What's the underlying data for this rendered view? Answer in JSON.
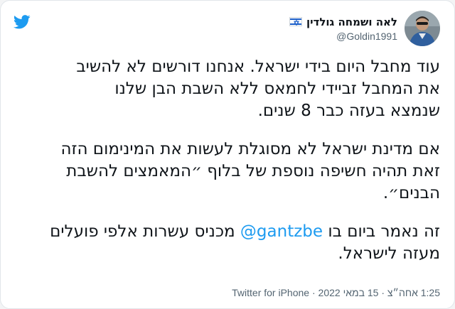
{
  "tweet": {
    "author": {
      "display_name": "לאה ושמחה גולדין",
      "handle": "@Goldin1991",
      "flag_icon": "israel-flag-icon",
      "avatar_icon": "profile-photo"
    },
    "paragraphs": [
      {
        "lines": "עוד מחבל היום בידי ישראל. אנחנו דורשים לא להשיב\nאת המחבל זביידי לחמאס ללא השבת הבן שלנו\nשנמצא בעזה כבר 8 שנים."
      },
      {
        "lines": "אם מדינת ישראל לא מסוגלת לעשות את המינימום הזה\nזאת תהיה חשיפה נוספת של בלוף ״המאמצים להשבת\nהבנים״."
      },
      {
        "before": "זה נאמר ביום בו ",
        "mention": "@gantzbe",
        "after": " מכניס עשרות אלפי פועלים\nמעזה לישראל."
      }
    ],
    "timestamp": "1:25 אחה״צ · 15 במאי 2022",
    "separator": " · ",
    "source": "Twitter for iPhone"
  },
  "colors": {
    "link": "#1d9bf0",
    "text": "#0f1419",
    "secondary": "#536471",
    "flag_blue": "#1c5fc9"
  }
}
